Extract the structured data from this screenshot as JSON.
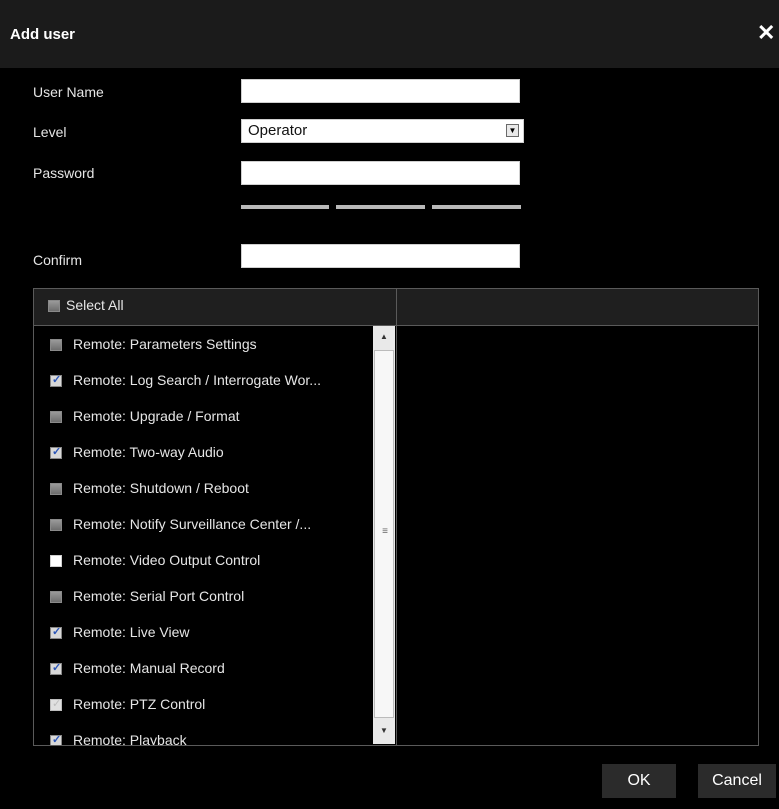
{
  "dialog": {
    "title": "Add user",
    "close_symbol": "✕"
  },
  "form": {
    "user_name_label": "User Name",
    "user_name_value": "",
    "level_label": "Level",
    "level_value": "Operator",
    "password_label": "Password",
    "password_value": "",
    "confirm_label": "Confirm",
    "confirm_value": ""
  },
  "permissions": {
    "select_all_label": "Select All",
    "select_all_checked": false,
    "items": [
      {
        "label": "Remote: Parameters Settings",
        "checked": false
      },
      {
        "label": "Remote: Log Search / Interrogate Wor...",
        "checked": true
      },
      {
        "label": "Remote: Upgrade / Format",
        "checked": false
      },
      {
        "label": "Remote: Two-way Audio",
        "checked": true
      },
      {
        "label": "Remote: Shutdown / Reboot",
        "checked": false
      },
      {
        "label": "Remote: Notify Surveillance Center /...",
        "checked": false
      },
      {
        "label": "Remote: Video Output Control",
        "checked": false
      },
      {
        "label": "Remote: Serial Port Control",
        "checked": false
      },
      {
        "label": "Remote: Live View",
        "checked": true
      },
      {
        "label": "Remote: Manual Record",
        "checked": true
      },
      {
        "label": "Remote: PTZ Control",
        "checked": true
      },
      {
        "label": "Remote: Playback",
        "checked": true
      }
    ]
  },
  "buttons": {
    "ok_label": "OK",
    "cancel_label": "Cancel"
  },
  "colors": {
    "background": "#000000",
    "titlebar": "#1b1b1b",
    "checkmark": "#2b56b8"
  },
  "icons": {
    "close": "close-icon",
    "dropdown": "chevron-down-icon",
    "scroll_up": "scroll-up-arrow-icon",
    "scroll_down": "scroll-down-arrow-icon"
  }
}
